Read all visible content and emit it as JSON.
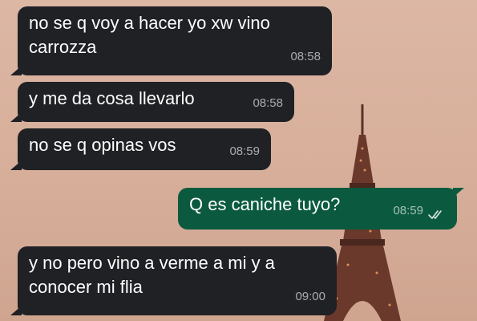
{
  "chat": {
    "messages": [
      {
        "direction": "incoming",
        "lines": [
          "no se q voy a hacer yo xw vino",
          "carrozza"
        ],
        "time": "08:58"
      },
      {
        "direction": "incoming",
        "lines": [
          "y me da cosa llevarlo"
        ],
        "time": "08:58"
      },
      {
        "direction": "incoming",
        "lines": [
          "no se q opinas vos"
        ],
        "time": "08:59"
      },
      {
        "direction": "outgoing",
        "lines": [
          "Q es caniche tuyo?"
        ],
        "time": "08:59",
        "status_icon": "double-check-read-icon"
      },
      {
        "direction": "incoming",
        "lines": [
          "y no pero vino a verme a mi y a",
          "conocer mi flia"
        ],
        "time": "09:00"
      }
    ]
  },
  "wallpaper": {
    "subject": "eiffel-tower-icon",
    "colors": {
      "sky": "#d8b09c",
      "tower": "#5a3127",
      "tower_lights": "#f0a060"
    }
  },
  "colors": {
    "incoming_bubble": "#1f2125",
    "outgoing_bubble": "#0b5a3f",
    "text": "#ffffff",
    "timestamp": "#bdbdbd",
    "read_ticks": "#dde8e4"
  }
}
